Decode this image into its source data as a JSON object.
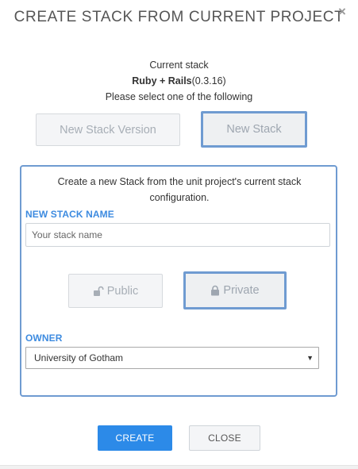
{
  "dialog": {
    "title": "CREATE STACK FROM CURRENT PROJECT",
    "close_glyph": "×"
  },
  "current": {
    "label": "Current stack",
    "stack_name": "Ruby + Rails",
    "stack_version": "(0.3.16)",
    "instruction": "Please select one of the following"
  },
  "options": {
    "new_version_label": "New Stack Version",
    "new_stack_label": "New Stack",
    "selected": "New Stack"
  },
  "panel": {
    "description": "Create a new Stack from the unit project's current stack configuration.",
    "name_label": "NEW STACK NAME",
    "name_value": "",
    "name_placeholder": "Your stack name",
    "public_label": "Public",
    "private_label": "Private",
    "visibility_selected": "Private",
    "owner_label": "OWNER",
    "owner_value": "University of Gotham"
  },
  "footer": {
    "create_label": "CREATE",
    "close_label": "CLOSE"
  },
  "icons": {
    "public": "unlock-icon",
    "private": "lock-icon",
    "close": "close-icon",
    "select": "chevron-down-icon"
  },
  "colors": {
    "accent": "#6f9bd1",
    "label_blue": "#3d8be0",
    "primary_button": "#2c8ae8"
  }
}
